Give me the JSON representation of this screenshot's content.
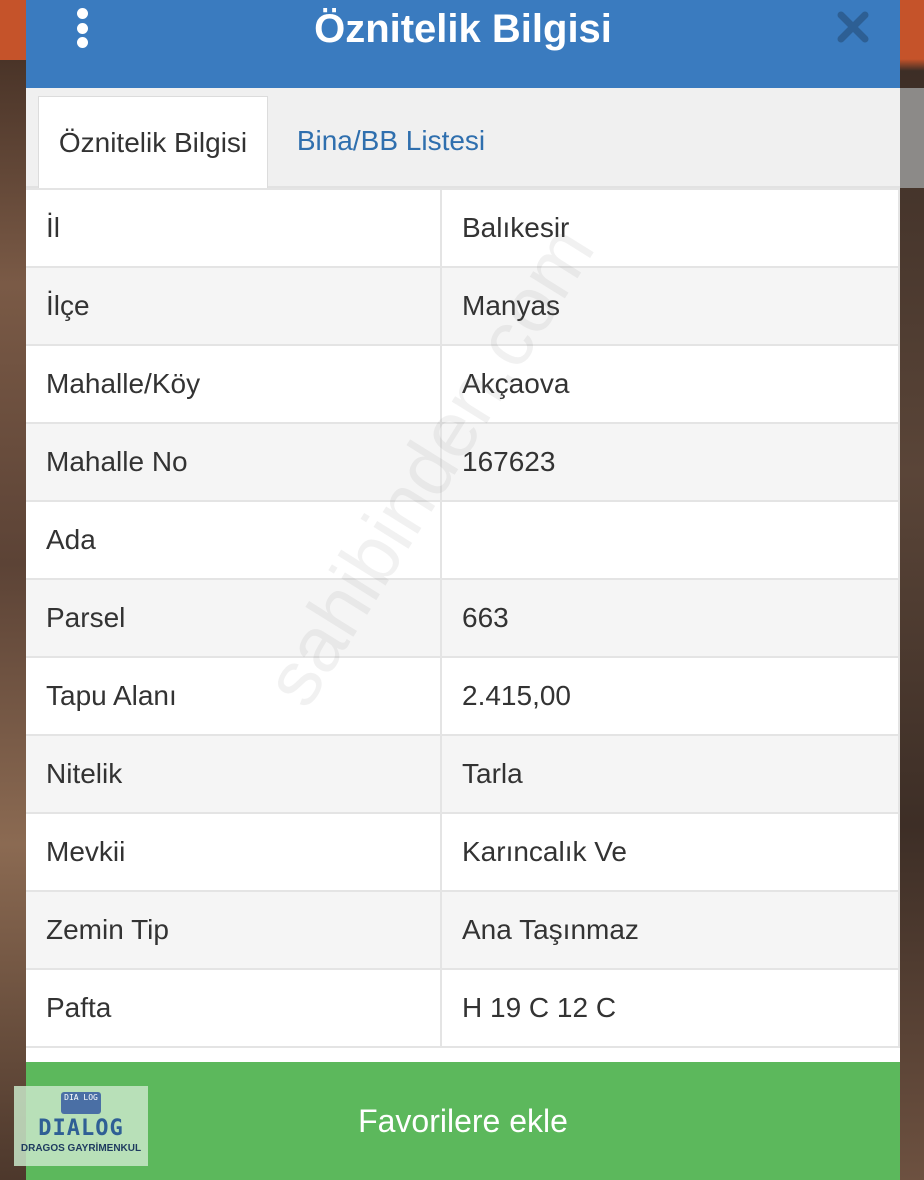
{
  "header": {
    "title": "Öznitelik Bilgisi",
    "menu_icon": "more-vertical-icon",
    "close_icon": "close-icon"
  },
  "tabs": [
    {
      "label": "Öznitelik Bilgisi",
      "active": true
    },
    {
      "label": "Bina/BB Listesi",
      "active": false
    }
  ],
  "rows": [
    {
      "key": "İl",
      "value": "Balıkesir"
    },
    {
      "key": "İlçe",
      "value": "Manyas"
    },
    {
      "key": "Mahalle/Köy",
      "value": "Akçaova"
    },
    {
      "key": "Mahalle No",
      "value": "167623"
    },
    {
      "key": "Ada",
      "value": ""
    },
    {
      "key": "Parsel",
      "value": "663"
    },
    {
      "key": "Tapu Alanı",
      "value": "2.415,00"
    },
    {
      "key": "Nitelik",
      "value": "Tarla"
    },
    {
      "key": "Mevkii",
      "value": "Karıncalık Ve"
    },
    {
      "key": "Zemin Tip",
      "value": "Ana Taşınmaz"
    },
    {
      "key": "Pafta",
      "value": "H 19 C 12 C"
    }
  ],
  "footer": {
    "favorite_label": "Favorilere ekle"
  },
  "watermark": "sahibinden.com",
  "logo": {
    "badge": "DIA LOG",
    "text": "DIALOG",
    "subtext": "DRAGOS GAYRİMENKUL"
  },
  "colors": {
    "header": "#3a7bbf",
    "favorite_button": "#5cb85c",
    "tab_link": "#2f6fae"
  }
}
